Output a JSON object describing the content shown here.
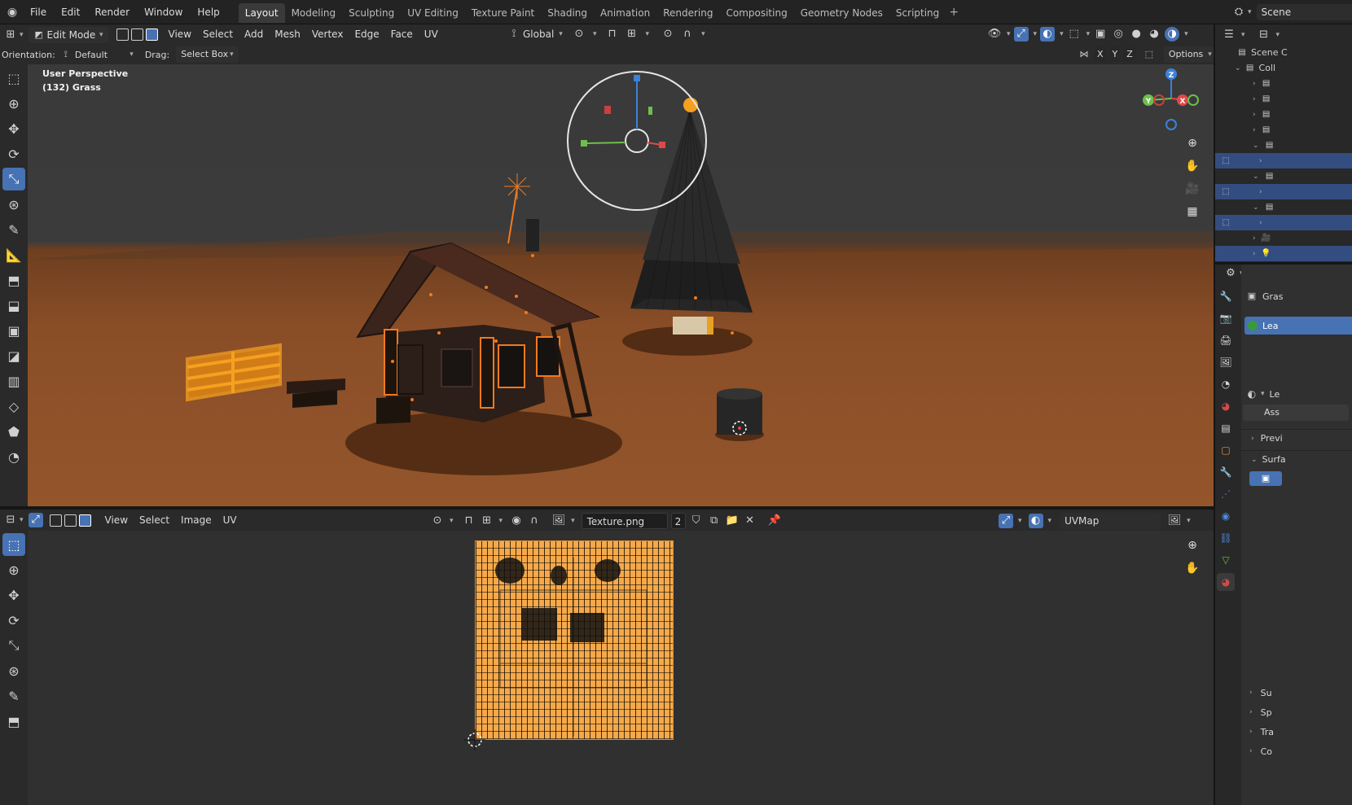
{
  "topbar": {
    "menus": [
      "File",
      "Edit",
      "Render",
      "Window",
      "Help"
    ],
    "workspaces": [
      "Layout",
      "Modeling",
      "Sculpting",
      "UV Editing",
      "Texture Paint",
      "Shading",
      "Animation",
      "Rendering",
      "Compositing",
      "Geometry Nodes",
      "Scripting"
    ],
    "active_workspace": "Layout",
    "scene_name": "Scene"
  },
  "viewport_header": {
    "mode": "Edit Mode",
    "menus": [
      "View",
      "Select",
      "Add",
      "Mesh",
      "Vertex",
      "Edge",
      "Face",
      "UV"
    ],
    "transform_orientation": "Global"
  },
  "tool_settings": {
    "orientation_label": "Orientation:",
    "orientation_value": "Default",
    "drag_label": "Drag:",
    "drag_value": "Select Box",
    "axes": [
      "X",
      "Y",
      "Z"
    ],
    "options_label": "Options"
  },
  "viewport_overlay": {
    "view_name": "User Perspective",
    "object_info": "(132) Grass"
  },
  "gizmo_axes": [
    "Z",
    "Y",
    "X"
  ],
  "uv_header": {
    "menus": [
      "View",
      "Select",
      "Image",
      "UV"
    ],
    "image_name": "Texture.png",
    "image_users": "2",
    "uv_map": "UVMap"
  },
  "outliner": {
    "scene_label": "Scene C",
    "collection_label": "Coll"
  },
  "properties": {
    "object_name": "Gras",
    "material_slot": "Lea",
    "material_field": "Le",
    "assign_button": "Ass",
    "panels": [
      "Previ",
      "Surfa"
    ],
    "bottom_panels": [
      "Su",
      "Sp",
      "Tra",
      "Co"
    ]
  },
  "colors": {
    "accent_blue": "#4772b3",
    "selection_orange": "#f5a94a"
  }
}
